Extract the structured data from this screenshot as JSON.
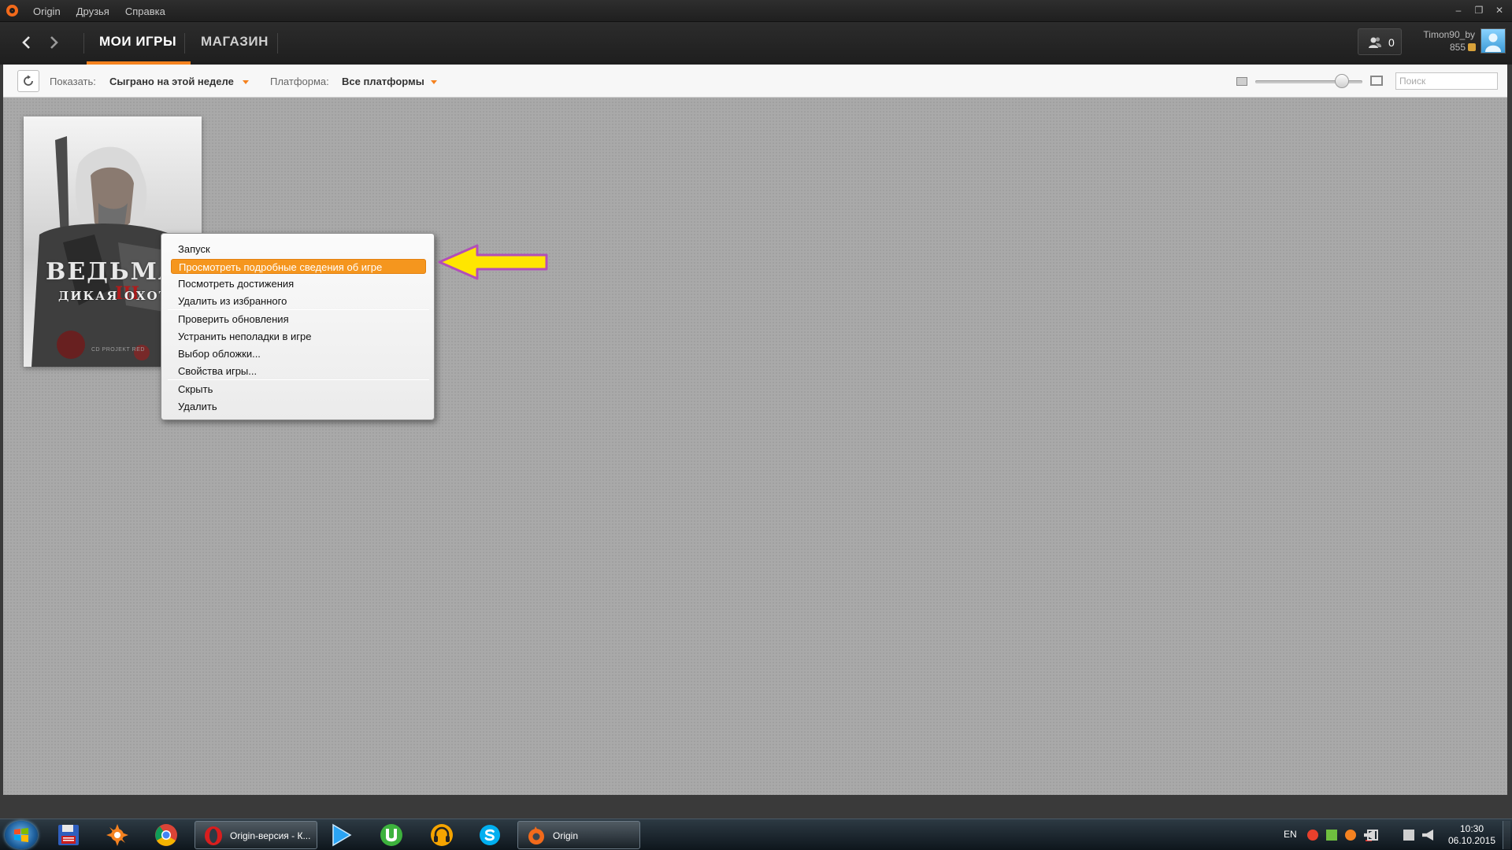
{
  "app": {
    "menu": [
      "Origin",
      "Друзья",
      "Справка"
    ]
  },
  "nav": {
    "tabs": [
      "МОИ ИГРЫ",
      "МАГАЗИН"
    ],
    "active_tab": 0
  },
  "user": {
    "friends_online": "0",
    "name": "Timon90_by",
    "points": "855"
  },
  "filter": {
    "show_label": "Показать:",
    "show_value": "Сыграно на этой неделе",
    "platform_label": "Платформа:",
    "platform_value": "Все платформы",
    "search_placeholder": "Поиск",
    "tile_size_level": 0.86
  },
  "game_tile": {
    "title": "ВЕДЬМАК",
    "numeral": "III",
    "subtitle": "ДИКАЯ ОХОТА",
    "brand": "CD PROJEKT RED"
  },
  "context_menu": {
    "groups": [
      [
        "Запуск",
        "Просмотреть подробные сведения об игре",
        "Посмотреть достижения",
        "Удалить из избранного"
      ],
      [
        "Проверить обновления",
        "Устранить неполадки в игре",
        "Выбор обложки...",
        "Свойства игры..."
      ],
      [
        "Скрыть",
        "Удалить"
      ]
    ],
    "highlighted": "Просмотреть подробные сведения об игре"
  },
  "colors": {
    "accent": "#f5821f",
    "annotation_arrow_fill": "#ffe600",
    "annotation_arrow_stroke": "#b24fb8"
  },
  "taskbar": {
    "tasks": [
      {
        "label": "Origin-версия - К...",
        "icon": "opera-icon"
      },
      {
        "label": "Origin",
        "icon": "origin-icon"
      }
    ],
    "pinned": [
      "floppy-icon",
      "avast-icon",
      "chrome-icon",
      "media-player-icon",
      "utorrent-icon",
      "headphones-icon",
      "skype-icon"
    ],
    "language": "EN",
    "time": "10:30",
    "date": "06.10.2015"
  }
}
